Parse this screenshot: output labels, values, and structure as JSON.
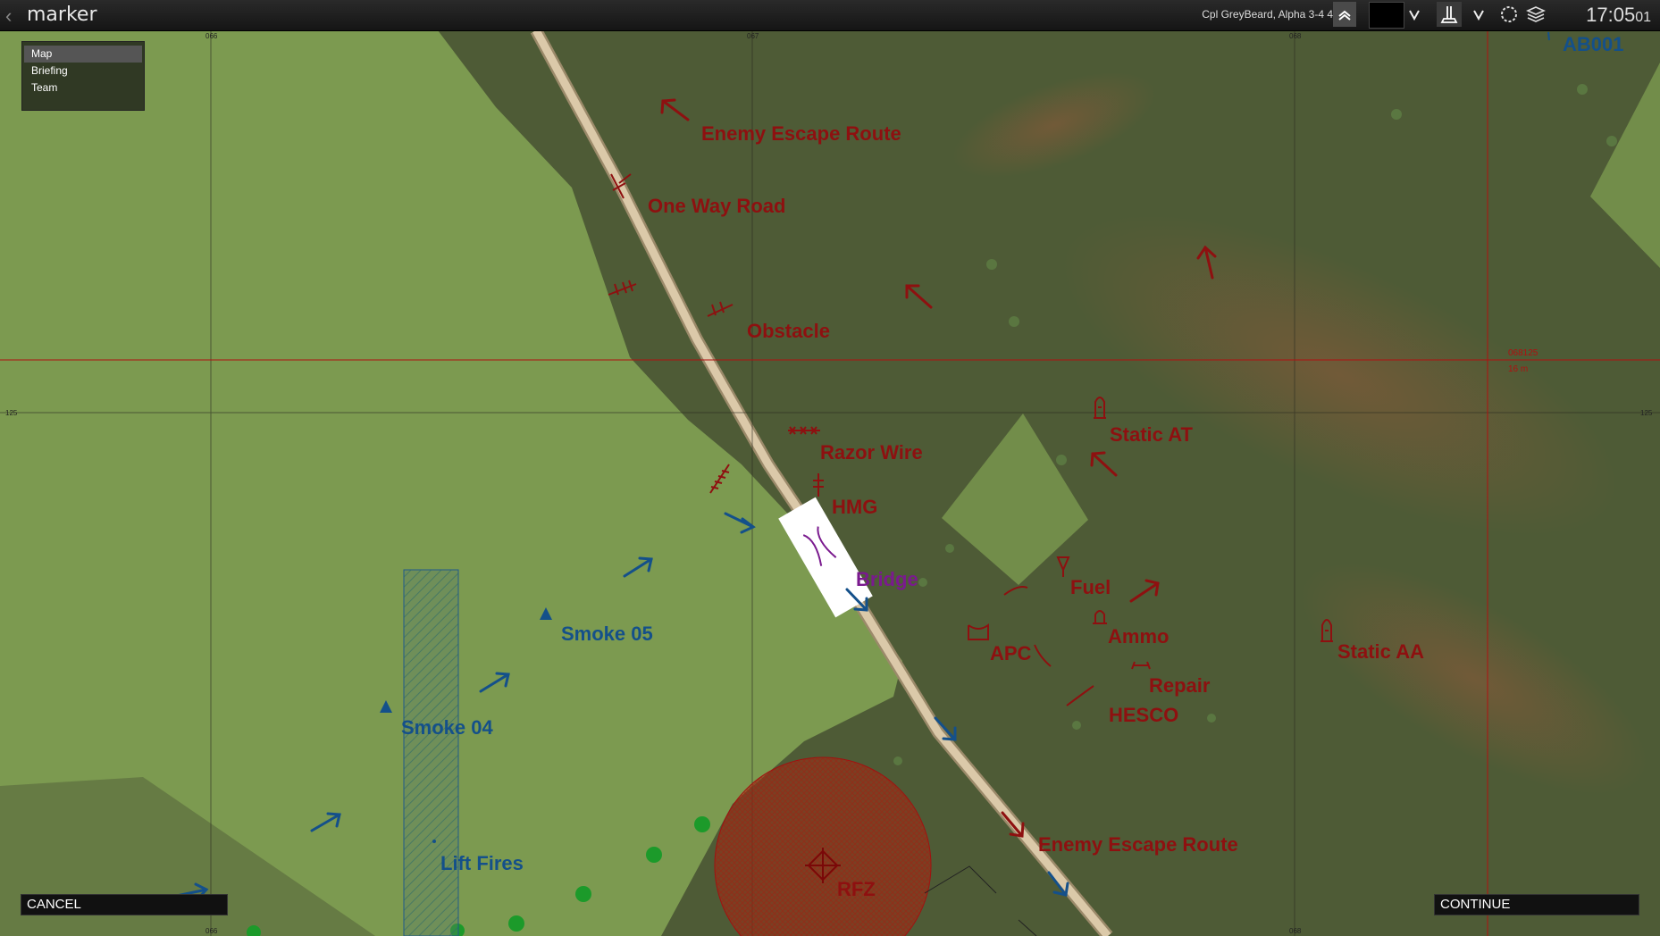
{
  "topbar": {
    "back_glyph": "‹",
    "title": "marker",
    "player": "Cpl GreyBeard, Alpha 3-4 4",
    "clock": "17:05",
    "clock_seconds": "01",
    "icons": [
      "rank-chevrons-icon",
      "color-swatch-icon",
      "chevron-down-icon",
      "marker-flag-icon",
      "chevron-down-icon",
      "circle-icon",
      "layers-icon"
    ]
  },
  "menu": {
    "items": [
      "Map",
      "Briefing",
      "Team"
    ]
  },
  "buttons": {
    "cancel": "CANCEL",
    "continue": "CONTINUE"
  },
  "grid": {
    "x_labels": [
      "066",
      "067",
      "068"
    ],
    "y_label": "125"
  },
  "cursor": {
    "grid_ref": "068125",
    "distance": "16 m"
  },
  "colors": {
    "opfor": "#8e1010",
    "blufor": "#14508a",
    "special": "#7a1a8e",
    "field_light": "#7c9a50",
    "field_dark": "#4e5b36",
    "road": "#d8c6a8"
  },
  "labels": {
    "enemy_escape_route_1": "Enemy Escape Route",
    "one_way_road": "One Way Road",
    "obstacle": "Obstacle",
    "razor_wire": "Razor Wire",
    "hmg": "HMG",
    "static_at": "Static AT",
    "bridge": "Bridge",
    "fuel": "Fuel",
    "ammo": "Ammo",
    "apc": "APC",
    "repair": "Repair",
    "hesco": "HESCO",
    "static_aa": "Static AA",
    "smoke_05": "Smoke 05",
    "smoke_04": "Smoke 04",
    "lift_fires": "Lift Fires",
    "rfz": "RFZ",
    "enemy_escape_route_2": "Enemy Escape Route",
    "ab001": "AB001"
  }
}
